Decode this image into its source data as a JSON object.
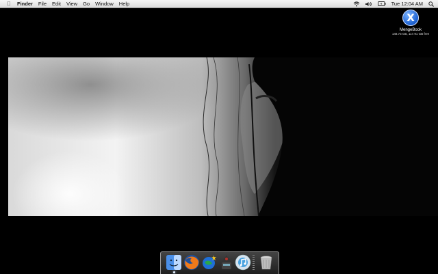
{
  "menubar": {
    "apple_icon": "apple-logo-icon",
    "app_name": "Finder",
    "items": [
      "File",
      "Edit",
      "View",
      "Go",
      "Window",
      "Help"
    ],
    "status": {
      "wifi_icon": "wifi-icon",
      "volume_icon": "volume-icon",
      "battery_icon": "battery-icon",
      "clock": "Tue 12:04 AM",
      "spotlight_icon": "spotlight-search-icon"
    }
  },
  "desktop": {
    "disk": {
      "icon": "mac-os-x-disk-icon",
      "glyph": "X",
      "name": "MengeBook",
      "info": "148.73 GB, 117.91 GB free"
    },
    "wallpaper": "black-and-white-photo-girl-hair"
  },
  "dock": {
    "items": [
      {
        "name": "Finder",
        "icon": "finder-icon",
        "running": true
      },
      {
        "name": "Firefox",
        "icon": "firefox-icon",
        "running": false
      },
      {
        "name": "Camino",
        "icon": "camino-icon",
        "running": false
      },
      {
        "name": "Adium",
        "icon": "adium-icon",
        "running": false
      },
      {
        "name": "iTunes",
        "icon": "itunes-icon",
        "running": false
      },
      {
        "name": "Trash",
        "icon": "trash-icon",
        "running": false
      }
    ]
  },
  "colors": {
    "desktop_bg": "#000000",
    "menubar_bg": "#e8e8e8",
    "disk_icon_blue": "#1b5fcf"
  }
}
